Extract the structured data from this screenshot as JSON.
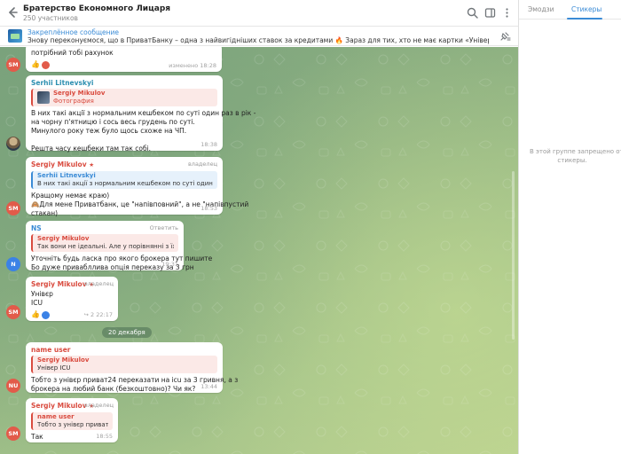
{
  "header": {
    "title": "Братерство Економного Лицаря",
    "subtitle": "250 участников"
  },
  "pinned": {
    "title": "Закреплённое сообщение",
    "text": "Знову переконуємося, що в ПриватБанку – одна з найвигідніших ставок за кредитами 🔥  Зараз для тих, хто не має картки «Універсальна» – кредитні кошти пі..."
  },
  "messages": {
    "m0": {
      "text": "потрібний тобі рахунок",
      "time": "изменено 18:28",
      "reaction": "👍"
    },
    "m1": {
      "sender": "Serhii Litnevskyi",
      "quote_name": "Sergiy Mikulov",
      "quote_text": "Фотография",
      "lines": [
        "В них такі акції з нормальним кешбеком по суті один раз в рік -",
        "на чорну п'ятницю і сось весь грудень по суті.",
        "Минулого року теж було щось схоже на ЧП.",
        "",
        "Решта часу кешбеки там так собі."
      ],
      "time": "18:38"
    },
    "m2": {
      "sender": "Sergiy Mikulov",
      "role": "владелец",
      "quote_name": "Serhii Litnevskyi",
      "quote_text": "В них такі акції з нормальним кешбеком по суті один раз в рік -...",
      "lines": [
        "Кращому немає краю)",
        "🙈Для мене Приватбанк, це \"напівповний\", а не \"напівпустий",
        "стакан)"
      ],
      "time": "18:53"
    },
    "m3": {
      "sender": "NS",
      "action": "Ответить",
      "quote_name": "Sergiy Mikulov",
      "quote_text": "Так вони не ідеальні. Але у порівнянні з їх перев...",
      "lines": [
        "Уточніть будь ласка про якого брокера тут пишите",
        "Бо дуже привабллива опція переказу за 3 грн"
      ],
      "time": "19:31"
    },
    "m4": {
      "sender": "Sergiy Mikulov",
      "role": "владелец",
      "lines": [
        "Унівєр",
        "ICU"
      ],
      "reaction": "👍",
      "replies": "2",
      "time": "22:17"
    },
    "date_divider": "20 декабря",
    "m5": {
      "sender": "name user",
      "quote_name": "Sergiy Mikulov",
      "quote_text": "Унівєр ICU",
      "lines": [
        "Тобто з унівєр приват24 переказати на icu за 3 гривня, а з",
        "брокера на любий банк (безкоштовно)? Чи як?"
      ],
      "time": "13:44"
    },
    "m6": {
      "sender": "Sergiy Mikulov",
      "role": "владелец",
      "quote_name": "name user",
      "quote_text": "Тобто з унівєр приват24...",
      "lines": [
        "Так"
      ],
      "time": "18:55"
    }
  },
  "avatars": {
    "sm": "SM",
    "n": "N",
    "nu": "NU"
  },
  "panel": {
    "tab_emoji": "Эмодзи",
    "tab_stickers": "Стикеры",
    "message_line1": "В этой группе запрещено отпра",
    "message_line2": "стикеры."
  },
  "colors": {
    "accent": "#3a8bd6",
    "name_red": "#d94b3f",
    "background": "#8fb282"
  }
}
